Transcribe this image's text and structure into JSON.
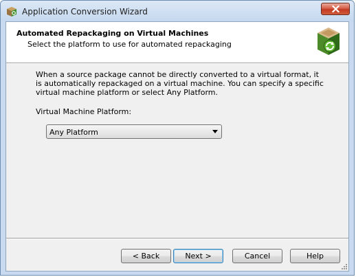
{
  "window": {
    "title": "Application Conversion Wizard",
    "icons": {
      "app": "wizard-app-icon",
      "close": "close-icon"
    }
  },
  "header": {
    "title": "Automated Repackaging on Virtual Machines",
    "subtitle": "Select the platform to use for automated repackaging",
    "icon": "package-refresh-icon"
  },
  "body": {
    "description": "When a source package cannot be directly converted to a virtual format, it is automatically repackaged on a virtual machine.  You can specify a specific virtual machine platform or select Any Platform.",
    "platform_label": "Virtual Machine Platform:",
    "platform_selected": "Any Platform"
  },
  "buttons": {
    "back": "< Back",
    "next": "Next >",
    "cancel": "Cancel",
    "help": "Help"
  },
  "colors": {
    "title_bar": "#c5d8ef",
    "close_button": "#c23a22",
    "dialog_background": "#f0f0f0",
    "default_button_border": "#3c7fb1"
  }
}
